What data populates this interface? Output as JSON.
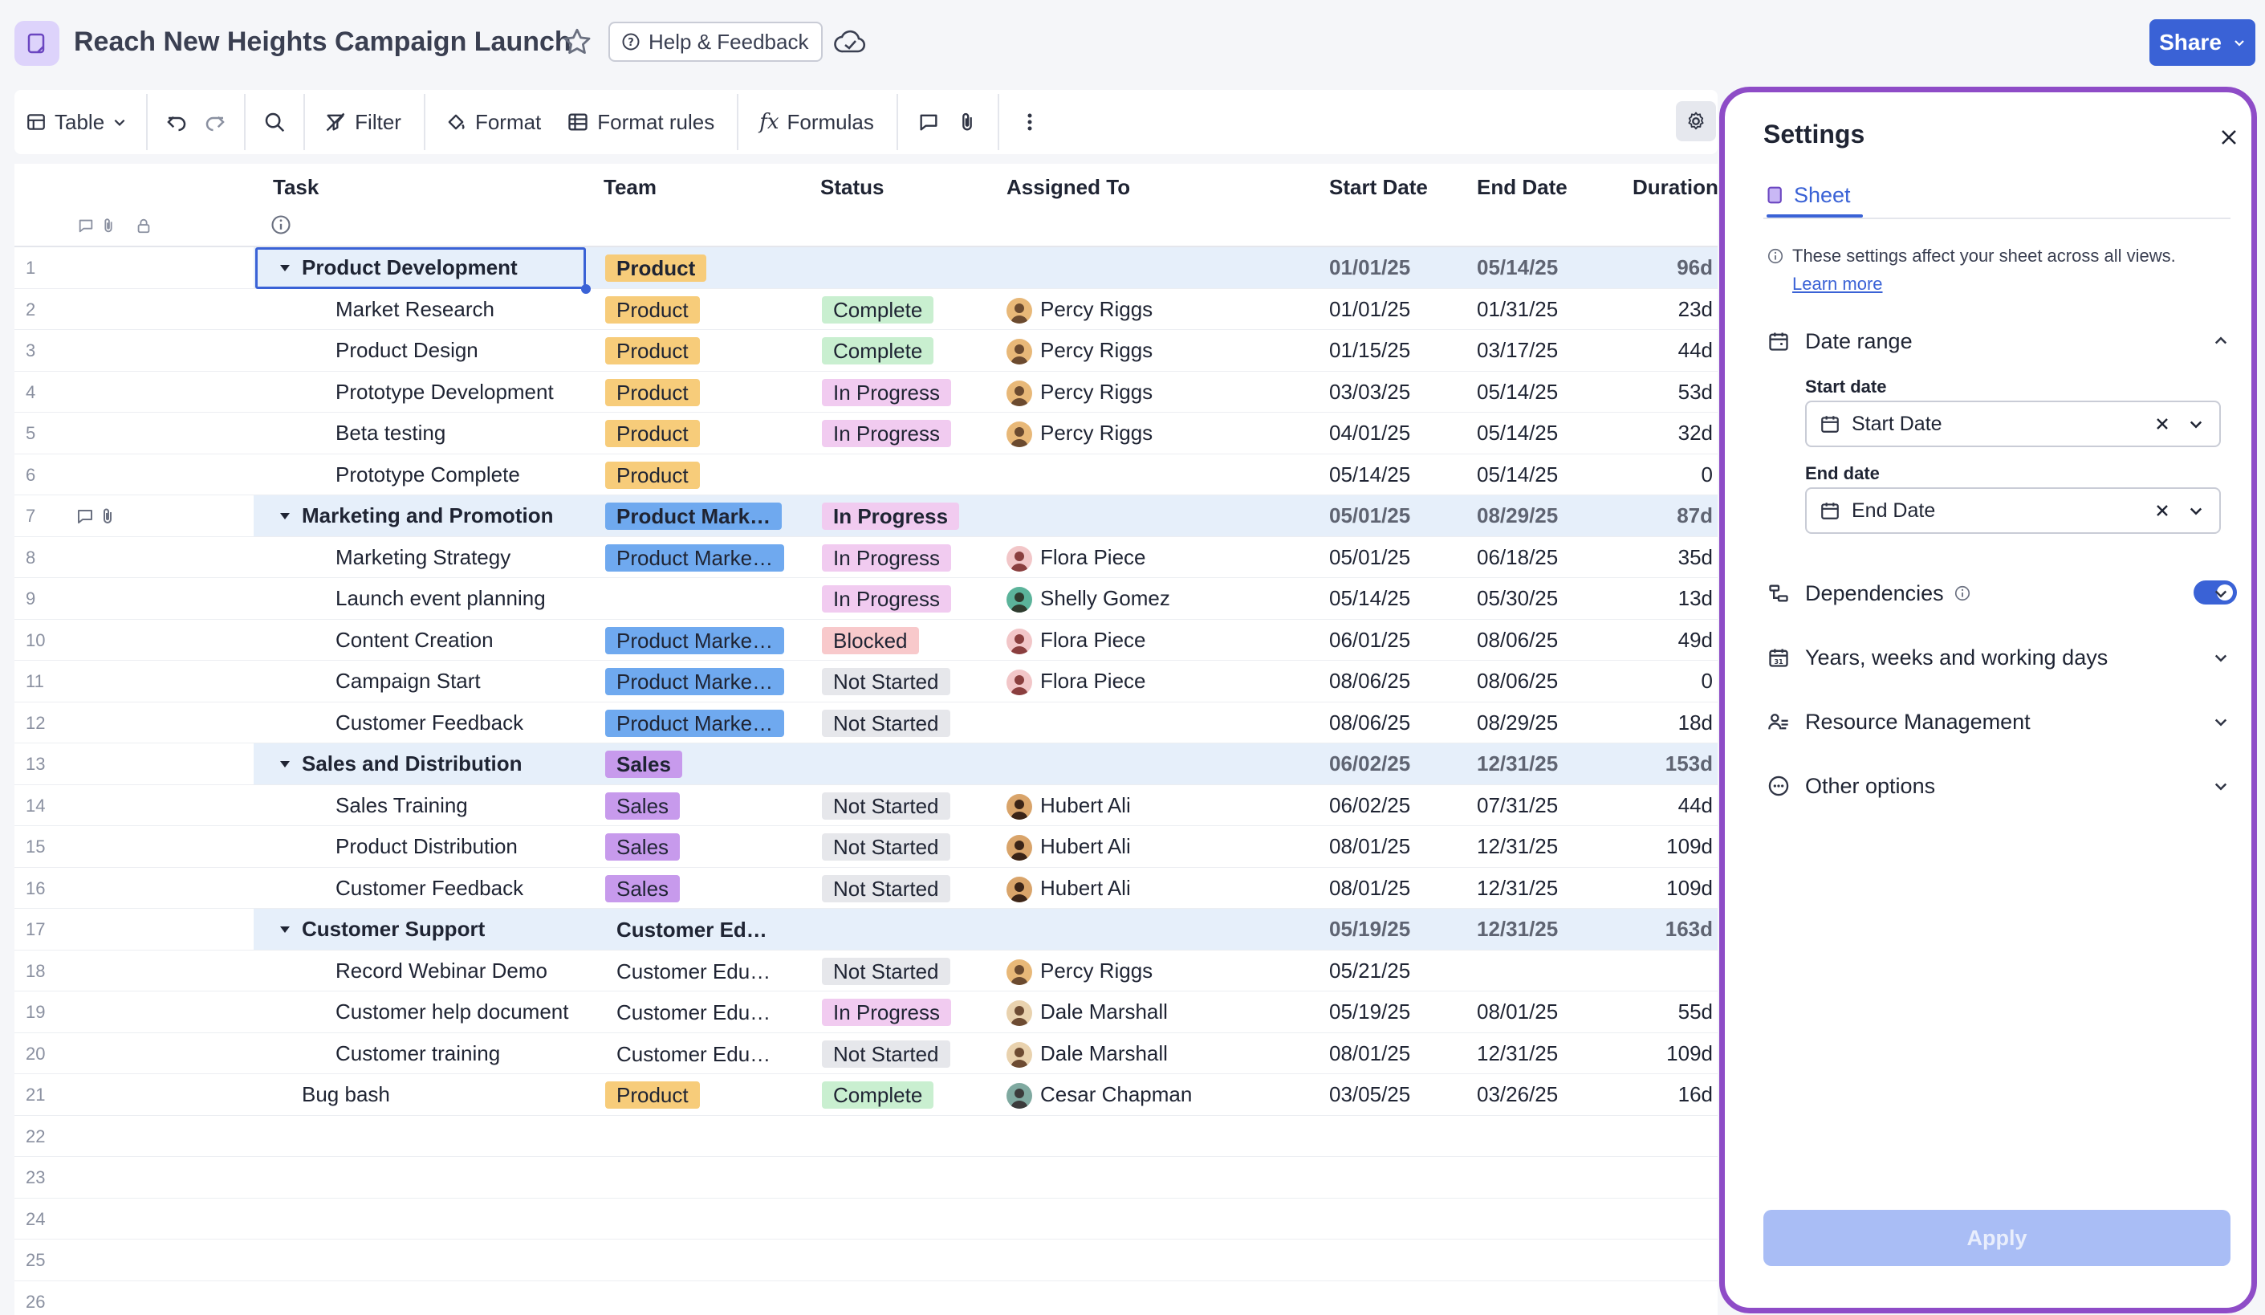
{
  "header": {
    "title": "Reach New Heights Campaign Launch",
    "help_label": "Help & Feedback",
    "share_label": "Share"
  },
  "toolbar": {
    "view_label": "Table",
    "filter_label": "Filter",
    "format_label": "Format",
    "format_rules_label": "Format rules",
    "formulas_label": "Formulas"
  },
  "columns": {
    "task": "Task",
    "team": "Team",
    "status": "Status",
    "assigned": "Assigned To",
    "start": "Start Date",
    "end": "End Date",
    "duration": "Duration"
  },
  "colors": {
    "accent": "#3a62d6",
    "panel_border": "#8e4cc7",
    "team_product": "#f7cc7a",
    "team_marketing": "#6fa9ef",
    "team_sales": "#c79aec",
    "status_complete": "#c9efd0",
    "status_in_progress": "#f1cbf0",
    "status_blocked": "#f8c9cb",
    "status_not_started": "#e6e7eb"
  },
  "rows": [
    {
      "num": "1",
      "task": "Product Development",
      "parent": true,
      "team": "Product",
      "team_style": "product",
      "status": "",
      "assigned": "",
      "avatar": "",
      "start": "01/01/25",
      "end": "05/14/25",
      "duration": "96d"
    },
    {
      "num": "2",
      "task": "Market Research",
      "team": "Product",
      "team_style": "product",
      "status": "Complete",
      "status_style": "complete",
      "assigned": "Percy Riggs",
      "avatar": "percy",
      "start": "01/01/25",
      "end": "01/31/25",
      "duration": "23d"
    },
    {
      "num": "3",
      "task": "Product Design",
      "team": "Product",
      "team_style": "product",
      "status": "Complete",
      "status_style": "complete",
      "assigned": "Percy Riggs",
      "avatar": "percy",
      "start": "01/15/25",
      "end": "03/17/25",
      "duration": "44d"
    },
    {
      "num": "4",
      "task": "Prototype Development",
      "team": "Product",
      "team_style": "product",
      "status": "In Progress",
      "status_style": "progress",
      "assigned": "Percy Riggs",
      "avatar": "percy",
      "start": "03/03/25",
      "end": "05/14/25",
      "duration": "53d"
    },
    {
      "num": "5",
      "task": "Beta testing",
      "team": "Product",
      "team_style": "product",
      "status": "In Progress",
      "status_style": "progress",
      "assigned": "Percy Riggs",
      "avatar": "percy",
      "start": "04/01/25",
      "end": "05/14/25",
      "duration": "32d"
    },
    {
      "num": "6",
      "task": "Prototype Complete",
      "team": "Product",
      "team_style": "product",
      "status": "",
      "assigned": "",
      "avatar": "",
      "start": "05/14/25",
      "end": "05/14/25",
      "duration": "0"
    },
    {
      "num": "7",
      "task": "Marketing and Promotion",
      "parent": true,
      "team": "Product Mark…",
      "team_style": "marketing",
      "status": "In Progress",
      "status_style": "progress",
      "assigned": "",
      "avatar": "",
      "start": "05/01/25",
      "end": "08/29/25",
      "duration": "87d",
      "icons": true
    },
    {
      "num": "8",
      "task": "Marketing Strategy",
      "team": "Product Marke…",
      "team_style": "marketing",
      "status": "In Progress",
      "status_style": "progress",
      "assigned": "Flora Piece",
      "avatar": "flora",
      "start": "05/01/25",
      "end": "06/18/25",
      "duration": "35d"
    },
    {
      "num": "9",
      "task": "Launch event planning",
      "team": "",
      "team_style": "",
      "status": "In Progress",
      "status_style": "progress",
      "assigned": "Shelly Gomez",
      "avatar": "shelly",
      "start": "05/14/25",
      "end": "05/30/25",
      "duration": "13d"
    },
    {
      "num": "10",
      "task": "Content Creation",
      "team": "Product Marke…",
      "team_style": "marketing",
      "status": "Blocked",
      "status_style": "blocked",
      "assigned": "Flora Piece",
      "avatar": "flora",
      "start": "06/01/25",
      "end": "08/06/25",
      "duration": "49d"
    },
    {
      "num": "11",
      "task": "Campaign Start",
      "team": "Product Marke…",
      "team_style": "marketing",
      "status": "Not Started",
      "status_style": "notstarted",
      "assigned": "Flora Piece",
      "avatar": "flora",
      "start": "08/06/25",
      "end": "08/06/25",
      "duration": "0"
    },
    {
      "num": "12",
      "task": "Customer Feedback",
      "team": "Product Marke…",
      "team_style": "marketing",
      "status": "Not Started",
      "status_style": "notstarted",
      "assigned": "",
      "avatar": "",
      "start": "08/06/25",
      "end": "08/29/25",
      "duration": "18d"
    },
    {
      "num": "13",
      "task": "Sales and Distribution",
      "parent": true,
      "team": "Sales",
      "team_style": "sales",
      "status": "",
      "assigned": "",
      "avatar": "",
      "start": "06/02/25",
      "end": "12/31/25",
      "duration": "153d"
    },
    {
      "num": "14",
      "task": "Sales Training",
      "team": "Sales",
      "team_style": "sales",
      "status": "Not Started",
      "status_style": "notstarted",
      "assigned": "Hubert Ali",
      "avatar": "hubert",
      "start": "06/02/25",
      "end": "07/31/25",
      "duration": "44d"
    },
    {
      "num": "15",
      "task": "Product Distribution",
      "team": "Sales",
      "team_style": "sales",
      "status": "Not Started",
      "status_style": "notstarted",
      "assigned": "Hubert Ali",
      "avatar": "hubert",
      "start": "08/01/25",
      "end": "12/31/25",
      "duration": "109d"
    },
    {
      "num": "16",
      "task": "Customer Feedback",
      "team": "Sales",
      "team_style": "sales",
      "status": "Not Started",
      "status_style": "notstarted",
      "assigned": "Hubert Ali",
      "avatar": "hubert",
      "start": "08/01/25",
      "end": "12/31/25",
      "duration": "109d"
    },
    {
      "num": "17",
      "task": "Customer Support",
      "parent": true,
      "team": "Customer Ed…",
      "team_style": "plain",
      "status": "",
      "assigned": "",
      "avatar": "",
      "start": "05/19/25",
      "end": "12/31/25",
      "duration": "163d"
    },
    {
      "num": "18",
      "task": "Record Webinar Demo",
      "team": "Customer Edu…",
      "team_style": "plain",
      "status": "Not Started",
      "status_style": "notstarted",
      "assigned": "Percy Riggs",
      "avatar": "percy",
      "start": "05/21/25",
      "end": "",
      "duration": ""
    },
    {
      "num": "19",
      "task": "Customer help document",
      "team": "Customer Edu…",
      "team_style": "plain",
      "status": "In Progress",
      "status_style": "progress",
      "assigned": "Dale Marshall",
      "avatar": "dale",
      "start": "05/19/25",
      "end": "08/01/25",
      "duration": "55d"
    },
    {
      "num": "20",
      "task": "Customer training",
      "team": "Customer Edu…",
      "team_style": "plain",
      "status": "Not Started",
      "status_style": "notstarted",
      "assigned": "Dale Marshall",
      "avatar": "dale",
      "start": "08/01/25",
      "end": "12/31/25",
      "duration": "109d"
    },
    {
      "num": "21",
      "task": "Bug bash",
      "top_level": true,
      "team": "Product",
      "team_style": "product",
      "status": "Complete",
      "status_style": "complete",
      "assigned": "Cesar Chapman",
      "avatar": "cesar",
      "start": "03/05/25",
      "end": "03/26/25",
      "duration": "16d"
    },
    {
      "num": "22",
      "task": "",
      "team": "",
      "status": "",
      "assigned": "",
      "avatar": "",
      "start": "",
      "end": "",
      "duration": ""
    },
    {
      "num": "23",
      "task": "",
      "team": "",
      "status": "",
      "assigned": "",
      "avatar": "",
      "start": "",
      "end": "",
      "duration": ""
    },
    {
      "num": "24",
      "task": "",
      "team": "",
      "status": "",
      "assigned": "",
      "avatar": "",
      "start": "",
      "end": "",
      "duration": ""
    },
    {
      "num": "25",
      "task": "",
      "team": "",
      "status": "",
      "assigned": "",
      "avatar": "",
      "start": "",
      "end": "",
      "duration": ""
    },
    {
      "num": "26",
      "task": "",
      "team": "",
      "status": "",
      "assigned": "",
      "avatar": "",
      "start": "",
      "end": "",
      "duration": ""
    }
  ],
  "settings": {
    "title": "Settings",
    "tab_label": "Sheet",
    "info_text": "These settings affect your sheet across all views.",
    "learn_more": "Learn more",
    "date_range_label": "Date range",
    "start_date_label": "Start date",
    "start_date_value": "Start Date",
    "end_date_label": "End date",
    "end_date_value": "End Date",
    "dependencies_label": "Dependencies",
    "dependencies_on": true,
    "years_label": "Years, weeks and working days",
    "resource_label": "Resource Management",
    "other_label": "Other options",
    "apply_label": "Apply"
  }
}
